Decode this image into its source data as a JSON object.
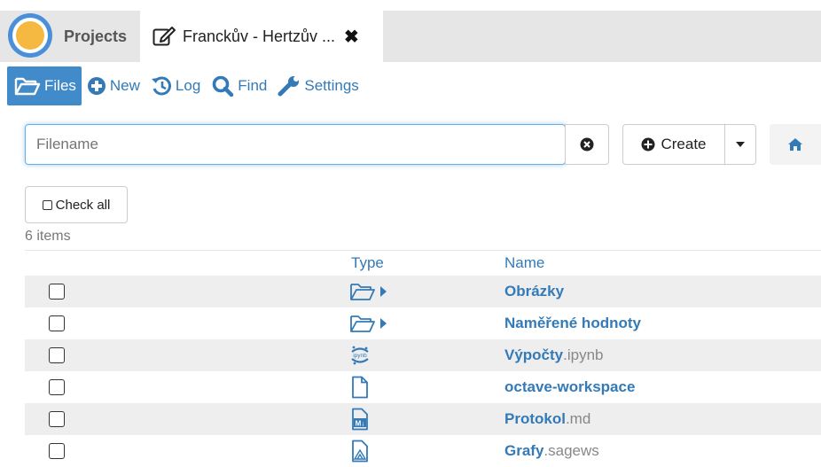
{
  "tabs": {
    "projects_label": "Projects",
    "file_tab_title": "Franckův - Hertzův ..."
  },
  "nav": {
    "files": "Files",
    "new": "New",
    "log": "Log",
    "find": "Find",
    "settings": "Settings"
  },
  "search": {
    "placeholder": "Filename"
  },
  "toolbar": {
    "create_label": "Create"
  },
  "listing": {
    "check_all_label": "Check all",
    "count": "6 items",
    "columns": {
      "type": "Type",
      "name": "Name"
    },
    "rows": [
      {
        "name": "Obrázky",
        "ext": "",
        "type_icon": "folder-open-icon"
      },
      {
        "name": "Naměřené hodnoty",
        "ext": "",
        "type_icon": "folder-open-icon"
      },
      {
        "name": "Výpočty",
        "ext": ".ipynb",
        "type_icon": "jupyter-icon"
      },
      {
        "name": "octave-workspace",
        "ext": "",
        "type_icon": "file-icon"
      },
      {
        "name": "Protokol",
        "ext": ".md",
        "type_icon": "markdown-icon"
      },
      {
        "name": "Grafy",
        "ext": ".sagews",
        "type_icon": "sagews-icon"
      }
    ]
  },
  "colors": {
    "accent": "#428bca",
    "link": "#337ab7",
    "logo_ring": "#4a90d9",
    "logo_center": "#f5b942"
  }
}
